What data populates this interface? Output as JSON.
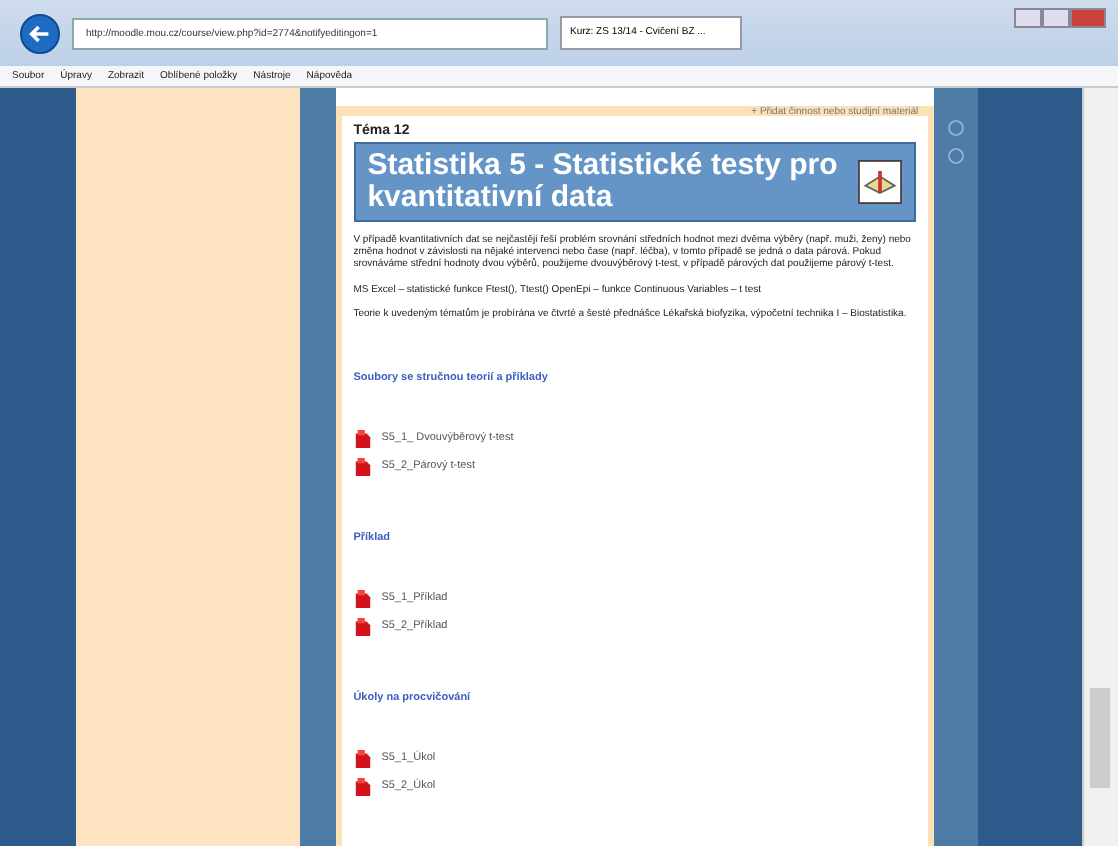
{
  "browser": {
    "address": "http://moodle.mou.cz/course/view.php?id=2774&notifyeditingon=1",
    "tab_title": "Kurz: ZS 13/14 - Cvičení BZ ...",
    "menu": [
      "Soubor",
      "Úpravy",
      "Zobrazit",
      "Oblíbené položky",
      "Nástroje",
      "Nápověda"
    ]
  },
  "add_activity": "+ Přidat činnost nebo studijní materiál",
  "topic": {
    "label": "Téma 12",
    "title": "Statistika 5 - Statistické testy pro kvantitativní data",
    "paragraphs": [
      "V případě kvantitativních dat se nejčastěji řeší problém srovnání středních hodnot mezi dvěma výběry (např. muži, ženy) nebo změna hodnot v závislosti na nějaké intervenci nebo čase (např. léčba), v tomto případě se jedná o data párová. Pokud srovnáváme střední hodnoty dvou výběrů, použijeme dvouvýběrový t-test, v případě párových dat použijeme párový t-test.",
      "MS Excel – statistické funkce Ftest(), Ttest() OpenEpi – funkce Continuous Variables – t test",
      "Teorie k uvedeným tématům je probírána ve čtvrté a šesté přednášce Lékařská biofyzika, výpočetní technika I – Biostatistika."
    ],
    "sections": [
      {
        "heading": "Soubory se stručnou teorií a příklady",
        "files": [
          "S5_1_ Dvouvýběrový t-test",
          "S5_2_Párový t-test"
        ]
      },
      {
        "heading": "Příklad",
        "files": [
          "S5_1_Příklad",
          "S5_2_Příklad"
        ]
      },
      {
        "heading": "Úkoly na procvičování",
        "files": [
          "S5_1_Úkol",
          "S5_2_Úkol"
        ]
      }
    ]
  }
}
